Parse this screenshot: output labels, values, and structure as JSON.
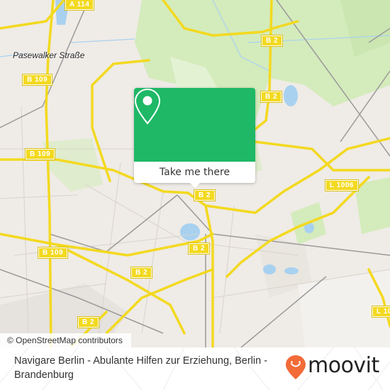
{
  "map": {
    "place_labels": [
      "Pasewalker Straße"
    ],
    "road_shields": [
      "A 114",
      "B 2",
      "B 2",
      "B 109",
      "B 109",
      "B 109",
      "B 2",
      "B 2",
      "B 2",
      "B 2",
      "L 1006",
      "L 10",
      "B 2"
    ],
    "attribution": "© OpenStreetMap contributors",
    "colors": {
      "land": "#efebe6",
      "park": "#d4ebbc",
      "water": "#a8d1f0",
      "road_major": "#f3d91f",
      "rail": "#999999"
    }
  },
  "popup": {
    "pin_icon": "map-pin-icon",
    "action_label": "Take me there",
    "accent_color": "#1eb866"
  },
  "footer": {
    "title": "Navigare Berlin - Abulante Hilfen zur Erziehung, Berlin - Brandenburg",
    "logo_text": "moovit",
    "logo_color": "#f26b38"
  }
}
